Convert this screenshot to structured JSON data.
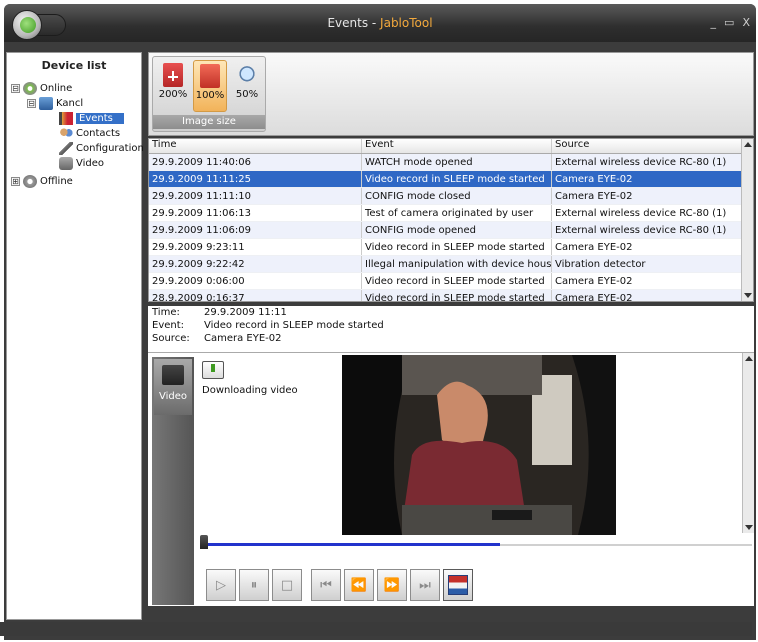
{
  "window": {
    "title_prefix": "Events - ",
    "title_app": "JabloTool",
    "controls": [
      "_",
      "▭",
      "X"
    ]
  },
  "sidebar": {
    "title": "Device list",
    "tree": [
      {
        "label": "Online",
        "expander": "⊟"
      },
      {
        "label": "Kancl",
        "expander": "⊟"
      },
      {
        "label": "Events"
      },
      {
        "label": "Contacts"
      },
      {
        "label": "Configuration"
      },
      {
        "label": "Video"
      },
      {
        "label": "Offline",
        "expander": "⊞"
      }
    ]
  },
  "toolbar": {
    "group_label": "Image size",
    "zoom": [
      {
        "label": "200%"
      },
      {
        "label": "100%",
        "active": true
      },
      {
        "label": "50%"
      }
    ]
  },
  "events": {
    "columns": [
      "Time",
      "Event",
      "Source"
    ],
    "rows": [
      [
        "29.9.2009 11:40:06",
        "WATCH mode opened",
        "External wireless device RC-80 (1)"
      ],
      [
        "29.9.2009 11:11:25",
        "Video record in SLEEP mode started",
        "Camera EYE-02"
      ],
      [
        "29.9.2009 11:11:10",
        "CONFIG mode closed",
        "Camera EYE-02"
      ],
      [
        "29.9.2009 11:06:13",
        "Test of camera originated by user",
        "External wireless device RC-80 (1)"
      ],
      [
        "29.9.2009 11:06:09",
        "CONFIG mode opened",
        "External wireless device RC-80 (1)"
      ],
      [
        "29.9.2009 9:23:11",
        "Video record in SLEEP mode started",
        "Camera EYE-02"
      ],
      [
        "29.9.2009 9:22:42",
        "Illegal manipulation with device housing",
        "Vibration detector"
      ],
      [
        "29.9.2009 0:06:00",
        "Video record in SLEEP mode started",
        "Camera EYE-02"
      ],
      [
        "28.9.2009 0:16:37",
        "Video record in SLEEP mode started",
        "Camera EYE-02"
      ]
    ],
    "selected_index": 1
  },
  "details": {
    "time_label": "Time:",
    "time": "29.9.2009 11:11",
    "event_label": "Event:",
    "event": "Video record in SLEEP mode started",
    "source_label": "Source:",
    "source": "Camera EYE-02"
  },
  "video": {
    "tab_label": "Video",
    "status": "Downloading video",
    "progress": 0.54
  }
}
